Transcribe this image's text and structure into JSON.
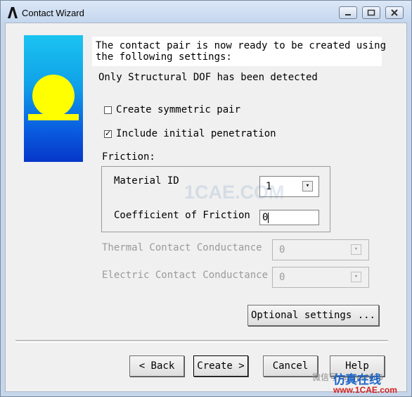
{
  "window": {
    "title": "Contact Wizard"
  },
  "message": {
    "line1": "The contact pair is now ready to be created using",
    "line2": "the following settings:",
    "dof_note": "Only Structural DOF has been detected"
  },
  "options": {
    "symmetric_pair": {
      "label": "Create symmetric pair",
      "checked": false
    },
    "initial_penetration": {
      "label": "Include initial penetration",
      "checked": true,
      "mark": "✓"
    }
  },
  "friction": {
    "group_label": "Friction:",
    "material_id_label": "Material ID",
    "material_id_value": "1",
    "coefficient_label": "Coefficient of Friction",
    "coefficient_value": "0"
  },
  "thermal": {
    "label": "Thermal Contact Conductance",
    "value": "0"
  },
  "electric": {
    "label": "Electric Contact Conductance",
    "value": "0"
  },
  "buttons": {
    "optional": "Optional settings ...",
    "back": "< Back",
    "create": "Create >",
    "cancel": "Cancel",
    "help": "Help"
  },
  "watermark": {
    "center": "1CAE.COM",
    "corner_left": "微信号: ansys2006",
    "corner_right": "仿真在线",
    "corner_url": "www.1CAE.com"
  }
}
